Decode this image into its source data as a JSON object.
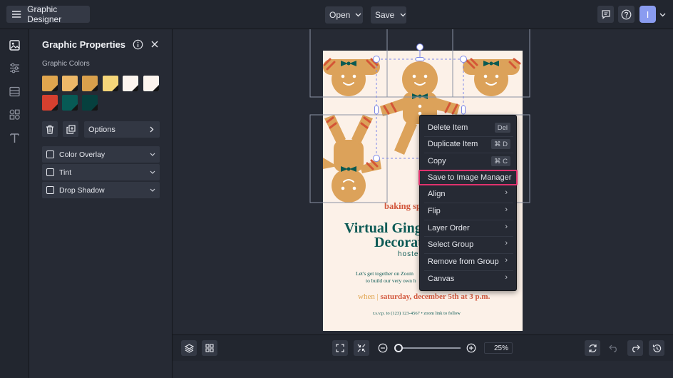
{
  "app": {
    "title": "Graphic Designer"
  },
  "toolbar": {
    "open_label": "Open",
    "save_label": "Save",
    "avatar_letter": "I"
  },
  "panel": {
    "title": "Graphic Properties",
    "colors_label": "Graphic Colors",
    "colors": [
      "#e0a64e",
      "#edb868",
      "#d9a04c",
      "#f5d67a",
      "#fdf5ef",
      "#fdf5ef",
      "#d6402f",
      "#075a55",
      "#06403e"
    ],
    "options_label": "Options",
    "effects": [
      {
        "label": "Color Overlay",
        "checked": false
      },
      {
        "label": "Tint",
        "checked": false
      },
      {
        "label": "Drop Shadow",
        "checked": false
      }
    ]
  },
  "flyer": {
    "tagline": "baking sp",
    "headline_1": "Virtual Ginge",
    "headline_2": "Decorat",
    "hosted": "hosted",
    "invite_1": "Let's get together on Zoom",
    "invite_2": "to build our very own h",
    "when_label": "when",
    "when_value": "saturday, december 5th at 3 p.m.",
    "rsvp": "r.s.v.p. to (123) 123-4567 • zoom link to follow"
  },
  "context_menu": {
    "items": [
      {
        "label": "Delete Item",
        "shortcut": "Del"
      },
      {
        "label": "Duplicate Item",
        "shortcut": "⌘ D"
      },
      {
        "label": "Copy",
        "shortcut": "⌘ C"
      },
      {
        "label": "Save to Image Manager",
        "highlighted": true
      },
      {
        "label": "Align",
        "submenu": true
      },
      {
        "label": "Flip",
        "submenu": true
      },
      {
        "label": "Layer Order",
        "submenu": true
      },
      {
        "label": "Select Group",
        "submenu": true
      },
      {
        "label": "Remove from Group",
        "submenu": true
      },
      {
        "label": "Canvas",
        "submenu": true
      }
    ]
  },
  "zoom": {
    "value": "25%",
    "level": 0.05
  },
  "accent_color": "#e0326e"
}
